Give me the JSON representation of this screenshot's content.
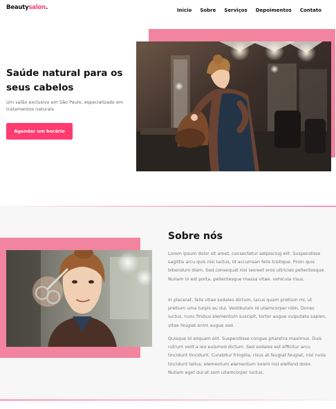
{
  "header": {
    "logo_main": "Beauty",
    "logo_accent": "salon",
    "logo_dot": ".",
    "nav": [
      "Início",
      "Sobre",
      "Serviços",
      "Depoimentos",
      "Contato"
    ]
  },
  "hero": {
    "title": "Saúde natural para os seus cabelos",
    "subtitle": "Um salão exclusivo em São Paulo, especializado em tratamentos naturais.",
    "cta_label": "Agendar um horário"
  },
  "about": {
    "title": "Sobre nós",
    "paragraphs": [
      "Lorem ipsum dolor sit amet, consectetur adipiscing elit. Suspendisse sagittis arcu quis nisi luctus, id accumsan felis tristique. Proin quis bibendum diam. Sed consequat nisl laoreet eros ultricies pellentesque. Nullam in est porta, pellentesque massa vitae, vehicula risus.",
      "In placerat, felis vitae sodales dictum, lacus quam pretium mi, ut pretium urna turpis eu dui. Vestibulum id ullamcorper nibh. Donec luctus, nunc finibus elementum suscipit, tortor augue vulputate sapien, vitae feugiat enim augue sed.",
      "Quisque id aliquam elit. Suspendisse congue pharetra maximus. Duis rutrum velit a leo euismod dictum. Sed sodales est efficitur arcu tincidunt tincidunt. Curabitur fringilla, risus at feugiat feugiat, nisl nulla tincidunt tellus, elementum elementum lorem nisl eleifend dolor. Nullam eget dui at sem ullamcorper luctus."
    ]
  },
  "colors": {
    "accent": "#ff3b6f",
    "pink_block": "#f2849f",
    "section_bg": "#f7f7f7",
    "text_muted": "#777777"
  }
}
